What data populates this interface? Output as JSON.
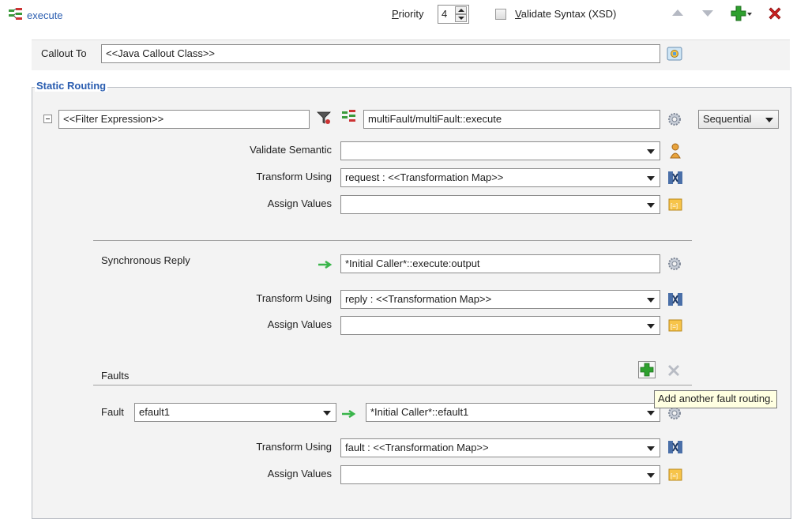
{
  "header": {
    "title": "execute",
    "priority_label": "Priority",
    "priority_value": "4",
    "validate_syntax_label": "Validate Syntax (XSD)",
    "validate_syntax_checked": false
  },
  "callout": {
    "label": "Callout To",
    "value": "<<Java Callout Class>>"
  },
  "static_routing": {
    "title": "Static Routing",
    "filter_expression": "<<Filter Expression>>",
    "target_service": "multiFault/multiFault::execute",
    "execution_mode": "Sequential",
    "request": {
      "validate_semantic_label": "Validate Semantic",
      "validate_semantic_value": "",
      "transform_using_label": "Transform Using",
      "transform_using_value": "request : <<Transformation Map>>",
      "assign_values_label": "Assign Values",
      "assign_values_value": ""
    },
    "reply": {
      "label": "Synchronous Reply",
      "target": "*Initial Caller*::execute:output",
      "transform_using_label": "Transform Using",
      "transform_using_value": "reply : <<Transformation Map>>",
      "assign_values_label": "Assign Values",
      "assign_values_value": ""
    },
    "faults": {
      "label": "Faults",
      "fault_label": "Fault",
      "fault_value": "efault1",
      "fault_target": "*Initial Caller*::efault1",
      "transform_using_label": "Transform Using",
      "transform_using_value": "fault : <<Transformation Map>>",
      "assign_values_label": "Assign Values",
      "assign_values_value": "",
      "tooltip": "Add another fault routing."
    }
  },
  "colors": {
    "accent_blue": "#2a5db0",
    "add_green": "#2ea02e",
    "delete_red": "#cc2222",
    "arrow_green": "#39b54a"
  }
}
